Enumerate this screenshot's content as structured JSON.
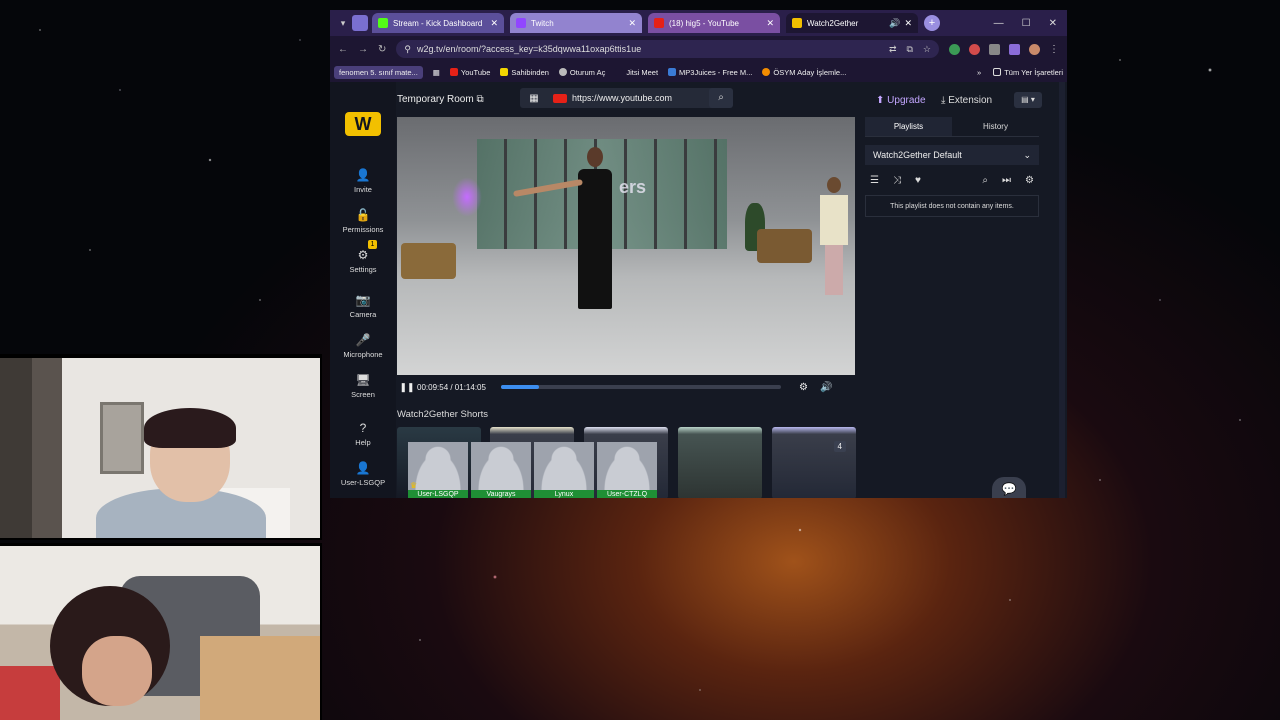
{
  "browser": {
    "tabs": [
      {
        "title": "Stream - Kick Dashboard",
        "close": "✕"
      },
      {
        "title": "Twitch",
        "close": "✕"
      },
      {
        "title": "(18) hig5 - YouTube",
        "close": "✕"
      },
      {
        "title": "Watch2Gether",
        "close": "✕"
      }
    ],
    "new_tab": "+",
    "address": "w2g.tv/en/room/?access_key=k35dqwwa11oxap6ttis1ue",
    "bookmarks": [
      {
        "label": "fenomen 5. sınıf mate..."
      },
      {
        "label": "YouTube"
      },
      {
        "label": "Sahibinden"
      },
      {
        "label": "Oturum Aç"
      },
      {
        "label": "Jitsi Meet"
      },
      {
        "label": "MP3Juices - Free M..."
      },
      {
        "label": "ÖSYM Aday İşlemle..."
      }
    ],
    "bookmarks_more": "»",
    "all_bookmarks": "Tüm Yer İşaretleri"
  },
  "w2g": {
    "sidebar": [
      {
        "label": "Invite",
        "icon": "user-plus-icon"
      },
      {
        "label": "Permissions",
        "icon": "unlock-icon"
      },
      {
        "label": "Settings",
        "icon": "gear-icon"
      },
      {
        "label": "Camera",
        "icon": "camera-icon"
      },
      {
        "label": "Microphone",
        "icon": "microphone-icon"
      },
      {
        "label": "Screen",
        "icon": "monitor-icon"
      },
      {
        "label": "Help",
        "icon": "help-icon"
      },
      {
        "label": "User-LSGQP",
        "icon": "user-icon"
      }
    ],
    "settings_badge": "1",
    "room_title": "Temporary Room",
    "url_value": "https://www.youtube.com",
    "upgrade": "Upgrade",
    "extension": "Extension",
    "video_overlay_text": "ers",
    "player": {
      "time": "00:09:54 / 01:14:05",
      "progress": 0.134
    },
    "shorts_title": "Watch2Gether Shorts",
    "shorts_count": "4",
    "users": [
      "User-LSGQP",
      "Vaugrays",
      "Lynux",
      "User-CTZLQ"
    ],
    "panel": {
      "tabs": [
        "Playlists",
        "History"
      ],
      "playlist_name": "Watch2Gether Default",
      "empty_message": "This playlist does not contain any items."
    }
  }
}
